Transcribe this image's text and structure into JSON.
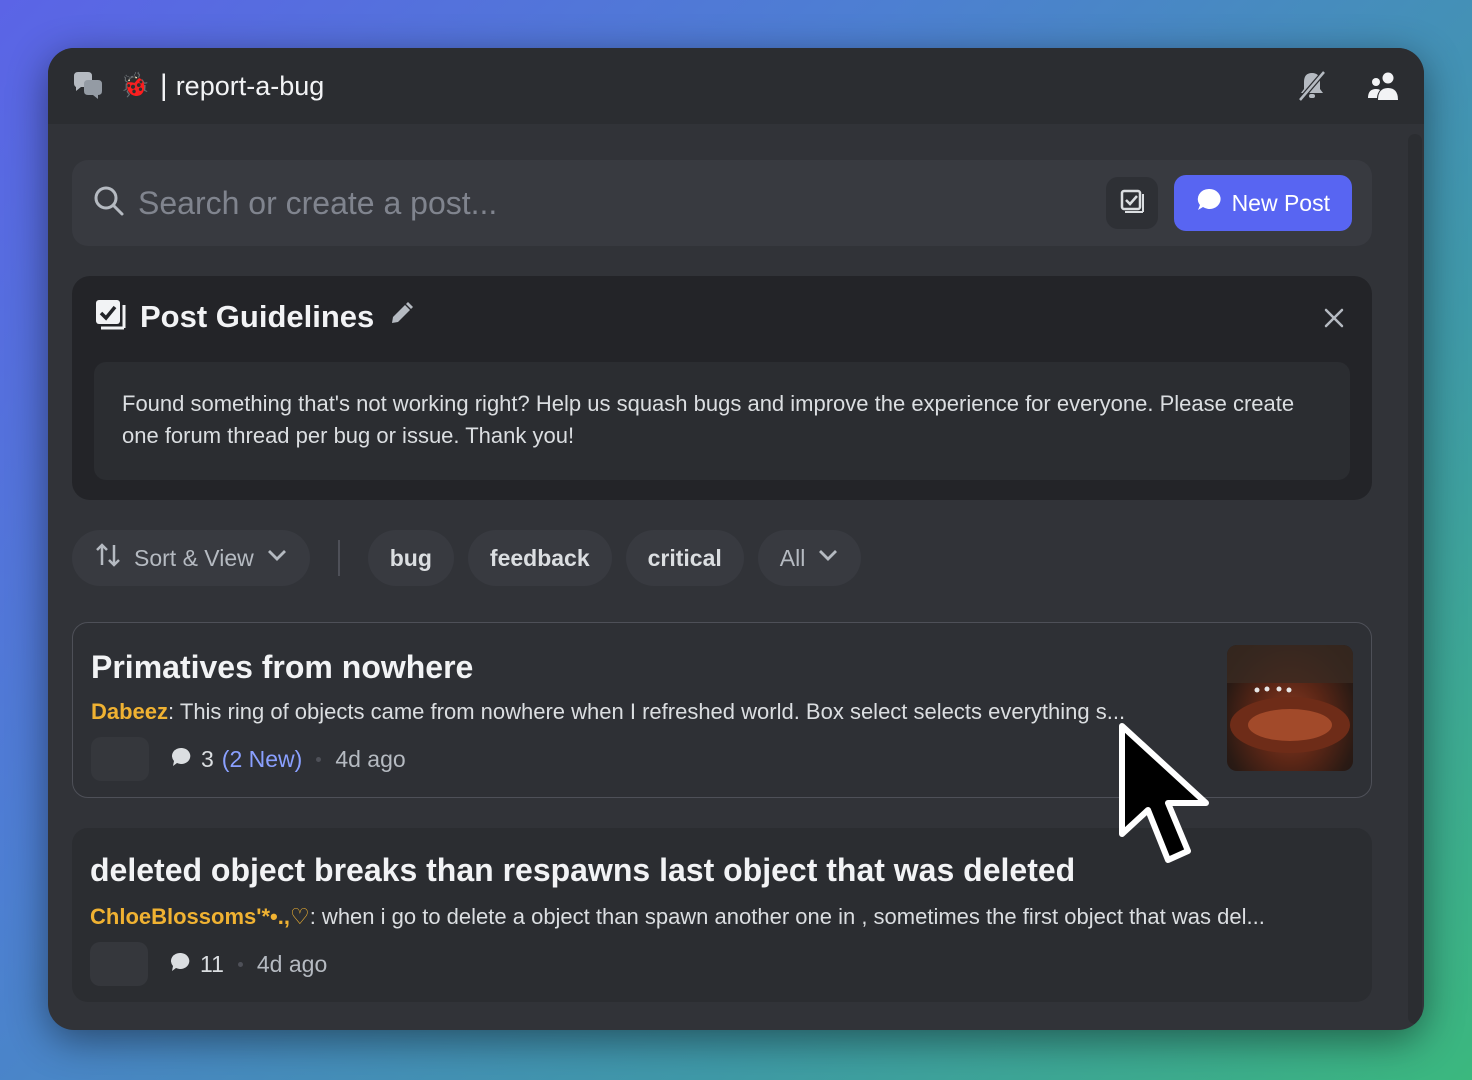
{
  "titlebar": {
    "channel_name": "report-a-bug",
    "separator": "|",
    "emoji": "🐞",
    "icons": [
      "forum-icon",
      "bell-slash-icon",
      "members-icon"
    ]
  },
  "search": {
    "placeholder": "Search or create a post...",
    "new_post_label": "New Post"
  },
  "guidelines": {
    "title": "Post Guidelines",
    "body": "Found something that's not working right? Help us squash bugs and improve the experience for everyone. Please create one forum thread per bug or issue. Thank you!"
  },
  "filters": {
    "sort_label": "Sort & View",
    "tags": [
      "bug",
      "feedback",
      "critical"
    ],
    "all_label": "All"
  },
  "posts": [
    {
      "title": "Primatives from nowhere",
      "author": "Dabeez",
      "preview": ": This ring of objects came from nowhere when I refreshed world. Box select selects everything s...",
      "replies": "3",
      "new_label": "(2 New)",
      "time": "4d ago"
    },
    {
      "title": "deleted object breaks than respawns last object that was deleted",
      "author": "ChloeBlossoms'*•.,♡",
      "preview": ": when i go to delete a object than spawn another one in , sometimes the first object that was del...",
      "replies": "11",
      "time": "4d ago"
    }
  ],
  "colors": {
    "accent": "#5865f2",
    "author": "#f0b232",
    "new_replies": "#8aa0ff"
  }
}
